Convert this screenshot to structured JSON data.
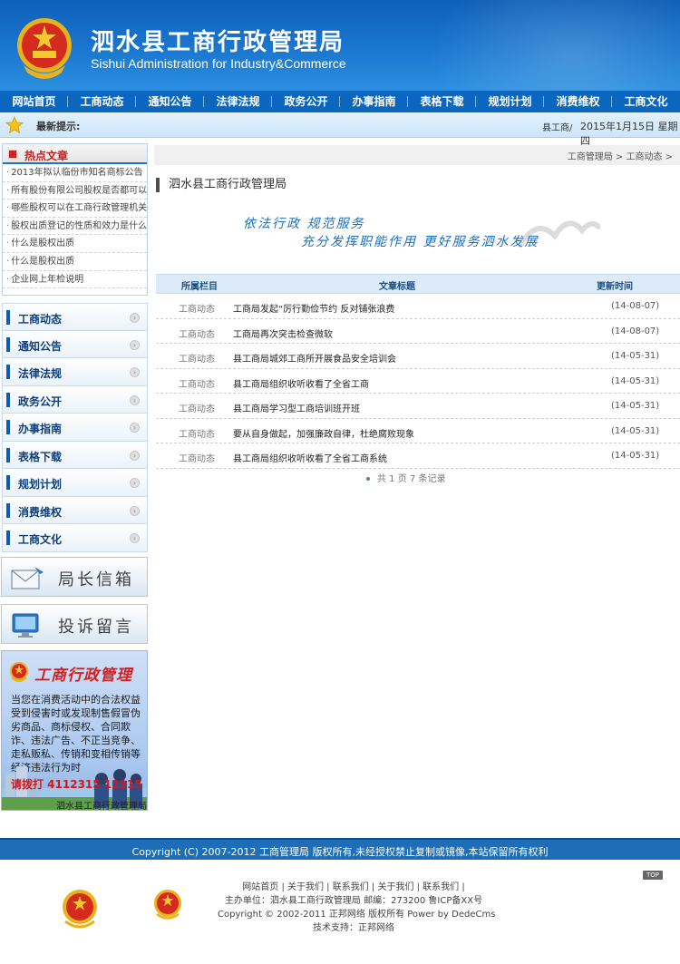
{
  "header": {
    "title": "泗水县工商行政管理局",
    "subtitle": "Sishui Administration for Industry&Commerce"
  },
  "nav": [
    {
      "label": "网站首页"
    },
    {
      "label": "工商动态"
    },
    {
      "label": "通知公告"
    },
    {
      "label": "法律法规"
    },
    {
      "label": "政务公开"
    },
    {
      "label": "办事指南"
    },
    {
      "label": "表格下载"
    },
    {
      "label": "规划计划"
    },
    {
      "label": "消费维权"
    },
    {
      "label": "工商文化"
    }
  ],
  "ticker": {
    "label": "最新提示:",
    "scroll_text": "县工商/",
    "date": "2015年1月15日 星期四"
  },
  "hot": {
    "title": "热点文章",
    "items": [
      "2013年拟认临份市知名商标公告",
      "所有股份有限公司股权是否都可以",
      "哪些股权可以在工商行政管理机关",
      "股权出质登记的性质和效力是什么",
      "什么是股权出质",
      "什么是股权出质",
      "企业网上年检说明"
    ]
  },
  "menu": [
    "工商动态",
    "通知公告",
    "法律法规",
    "政务公开",
    "办事指南",
    "表格下载",
    "规划计划",
    "消费维权",
    "工商文化"
  ],
  "buttons": {
    "mailbox": "局长信箱",
    "complaint": "投诉留言"
  },
  "banner": {
    "title": "工商行政管理",
    "text": "当您在消费活动中的合法权益受到侵害时或发现制售假冒伪劣商品、商标侵权、合同欺诈、违法广告、不正当竞争、走私贩私、传销和变相传销等经济违法行为时",
    "tel": "请拨打 4112315  12315",
    "org": "泗水县工商行政管理局"
  },
  "main": {
    "breadcrumb": "工商管理局 > 工商动态 >",
    "page_title": "泗水县工商行政管理局",
    "slogan1": "依法行政    规范服务",
    "slogan2": "充分发挥职能作用  更好服务泗水发展",
    "col_category": "所属栏目",
    "col_title": "文章标题",
    "col_date": "更新时间",
    "rows": [
      {
        "category": "工商动态",
        "title": "工商局发起“厉行勤俭节约 反对铺张浪费",
        "date": "(14-08-07)"
      },
      {
        "category": "工商动态",
        "title": "工商局再次突击检查微软",
        "date": "(14-08-07)"
      },
      {
        "category": "工商动态",
        "title": "县工商局城郊工商所开展食品安全培训会",
        "date": "(14-05-31)"
      },
      {
        "category": "工商动态",
        "title": "县工商局组织收听收看了全省工商",
        "date": "(14-05-31)"
      },
      {
        "category": "工商动态",
        "title": "县工商局学习型工商培训班开班",
        "date": "(14-05-31)"
      },
      {
        "category": "工商动态",
        "title": "要从自身做起，加强廉政自律，杜绝腐败现象",
        "date": "(14-05-31)"
      },
      {
        "category": "工商动态",
        "title": "县工商局组织收听收看了全省工商系统",
        "date": "(14-05-31)"
      }
    ],
    "pager": "共  1  页  7  条记录"
  },
  "footer": {
    "copyright": "Copyright (C) 2007-2012 工商管理局 版权所有,未经授权禁止复制或镜像,本站保留所有权利",
    "top": "TOP",
    "links": "网站首页 | 关于我们 | 联系我们 | 关于我们 | 联系我们 |",
    "host": "主办单位：泗水县工商行政管理局 邮编：273200 鲁ICP备XX号",
    "powered": "Copyright © 2002-2011 正邦网络 版权所有 Power by DedeCms",
    "support": "技术支持：正邦网络"
  },
  "colors": {
    "header_blue": "#1a77cf",
    "nav_blue": "#0a66be",
    "accent_red": "#c0231e"
  }
}
